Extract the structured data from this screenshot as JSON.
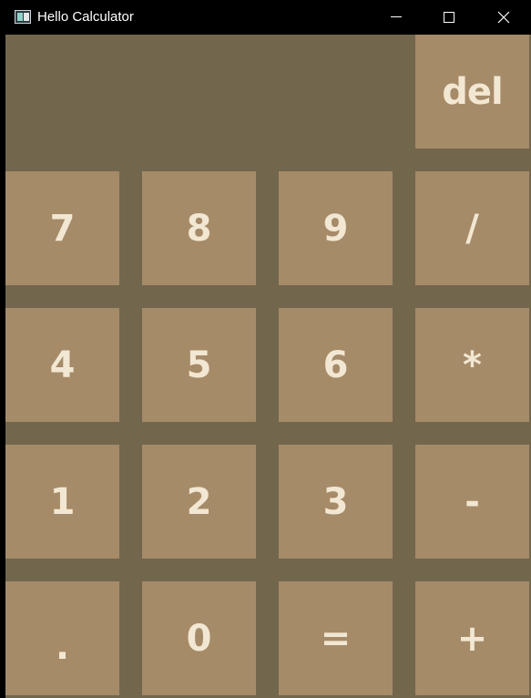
{
  "window": {
    "title": "Hello Calculator"
  },
  "display": {
    "value": ""
  },
  "keys": {
    "del": "del",
    "seven": "7",
    "eight": "8",
    "nine": "9",
    "divide": "/",
    "four": "4",
    "five": "5",
    "six": "6",
    "multiply": "*",
    "one": "1",
    "two": "2",
    "three": "3",
    "subtract": "-",
    "dot": ".",
    "zero": "0",
    "equals": "=",
    "add": "+"
  },
  "colors": {
    "background": "#72664d",
    "key": "#a68b69",
    "key_text": "#f2e7d2",
    "titlebar": "#000000"
  },
  "icons": {
    "app": "calculator-app-icon",
    "minimize": "minimize-icon",
    "maximize": "maximize-icon",
    "close": "close-icon"
  }
}
